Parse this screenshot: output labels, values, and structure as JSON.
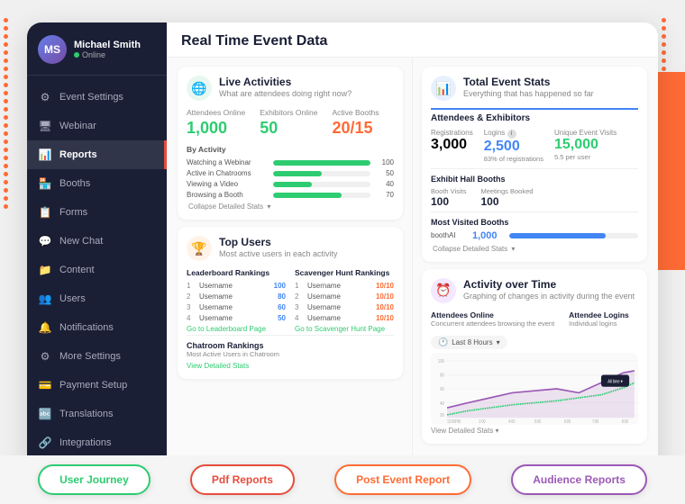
{
  "page": {
    "title": "Real Time Event Data"
  },
  "sidebar": {
    "profile": {
      "name": "Michael Smith",
      "status": "Online",
      "initials": "MS"
    },
    "nav_items": [
      {
        "id": "event-settings",
        "label": "Event Settings",
        "icon": "⚙"
      },
      {
        "id": "webinar",
        "label": "Webinar",
        "icon": "🖥"
      },
      {
        "id": "reports",
        "label": "Reports",
        "icon": "📊",
        "active": true
      },
      {
        "id": "booths",
        "label": "Booths",
        "icon": "🏪"
      },
      {
        "id": "forms",
        "label": "Forms",
        "icon": "📋"
      },
      {
        "id": "new-chat",
        "label": "New Chat",
        "icon": "💬"
      },
      {
        "id": "content",
        "label": "Content",
        "icon": "📁"
      },
      {
        "id": "users",
        "label": "Users",
        "icon": "👥"
      },
      {
        "id": "notifications",
        "label": "Notifications",
        "icon": "🔔"
      },
      {
        "id": "more-settings",
        "label": "More Settings",
        "icon": "⚙"
      },
      {
        "id": "payment-setup",
        "label": "Payment Setup",
        "icon": "💳"
      },
      {
        "id": "translations",
        "label": "Translations",
        "icon": "🔤"
      },
      {
        "id": "integrations",
        "label": "Integrations",
        "icon": "🔗"
      }
    ]
  },
  "live_activities": {
    "title": "Live Activities",
    "subtitle": "What are attendees doing right now?",
    "attendees_online_label": "Attendees Online",
    "attendees_online_value": "1,000",
    "exhibitors_online_label": "Exhibitors Online",
    "exhibitors_online_value": "50",
    "active_booths_label": "Active Booths",
    "active_booths_value": "20/15",
    "by_activity_title": "By Activity",
    "activities": [
      {
        "label": "Watching a Webinar",
        "value": 100,
        "max": 100
      },
      {
        "label": "Active in Chatrooms",
        "value": 50,
        "max": 100
      },
      {
        "label": "Viewing a Video",
        "value": 40,
        "max": 100
      },
      {
        "label": "Browsing a Booth",
        "value": 70,
        "max": 100
      }
    ],
    "collapse_link": "Collapse Detailed Stats"
  },
  "total_event_stats": {
    "title": "Total Event Stats",
    "subtitle": "Everything that has happened so far",
    "attendees_exhibitors_title": "Attendees & Exhibitors",
    "registrations_label": "Registrations",
    "registrations_value": "3,000",
    "logins_label": "Logins",
    "logins_value": "2,500",
    "logins_note": "83% of registrations",
    "unique_visits_label": "Unique Event Visits",
    "unique_visits_value": "15,000",
    "unique_visits_note": "5.5 per user",
    "exhibit_hall_title": "Exhibit Hall Booths",
    "booth_visits_label": "Booth Visits",
    "booth_visits_value": "100",
    "meetings_booked_label": "Meetings Booked",
    "meetings_booked_value": "100",
    "most_visited_title": "Most Visited Booths",
    "most_visited_booth": "boothAI",
    "most_visited_value": "1,000",
    "collapse_link": "Collapse Detailed Stats"
  },
  "top_users": {
    "title": "Top Users",
    "subtitle": "Most active users in each activity",
    "leaderboard_title": "Leaderboard Rankings",
    "leaderboard_rows": [
      {
        "rank": 1,
        "name": "Username",
        "score": "100"
      },
      {
        "rank": 2,
        "name": "Username",
        "score": "80"
      },
      {
        "rank": 3,
        "name": "Username",
        "score": "60"
      },
      {
        "rank": 4,
        "name": "Username",
        "score": "50"
      }
    ],
    "leaderboard_link": "Go to Leaderboard Page",
    "scavenger_title": "Scavenger Hunt Rankings",
    "scavenger_rows": [
      {
        "rank": 1,
        "name": "Username",
        "score": "10/10"
      },
      {
        "rank": 2,
        "name": "Username",
        "score": "10/10"
      },
      {
        "rank": 3,
        "name": "Username",
        "score": "10/10"
      },
      {
        "rank": 4,
        "name": "Username",
        "score": "10/10"
      }
    ],
    "scavenger_link": "Go to Scavenger Hunt Page",
    "chatroom_title": "Chatroom Rankings",
    "chatroom_subtitle": "Most Active Users in Chatroom",
    "view_stats_link": "View Detailed Stats"
  },
  "activity_over_time": {
    "title": "Activity over Time",
    "subtitle": "Graphing of changes in activity during the event",
    "attendees_online_title": "Attendees Online",
    "attendees_online_sub": "Concurrent attendees browsing the event",
    "attendee_logins_title": "Attendee Logins",
    "attendee_logins_sub": "Individual logins",
    "time_filter": "Last 8 Hours",
    "y_labels": [
      "100",
      "80",
      "60",
      "40",
      "20"
    ],
    "x_labels": [
      "12:00PM",
      "2:00",
      "4:00",
      "5:00",
      "6:00",
      "7:00",
      "8:00"
    ],
    "view_link": "View Detailed Stats"
  },
  "bottom_tabs": [
    {
      "id": "user-journey",
      "label": "User Journey",
      "color_class": "tab-green"
    },
    {
      "id": "pdf-reports",
      "label": "Pdf Reports",
      "color_class": "tab-red"
    },
    {
      "id": "post-event-report",
      "label": "Post Event Report",
      "color_class": "tab-orange"
    },
    {
      "id": "audience-reports",
      "label": "Audience Reports",
      "color_class": "tab-purple"
    }
  ]
}
